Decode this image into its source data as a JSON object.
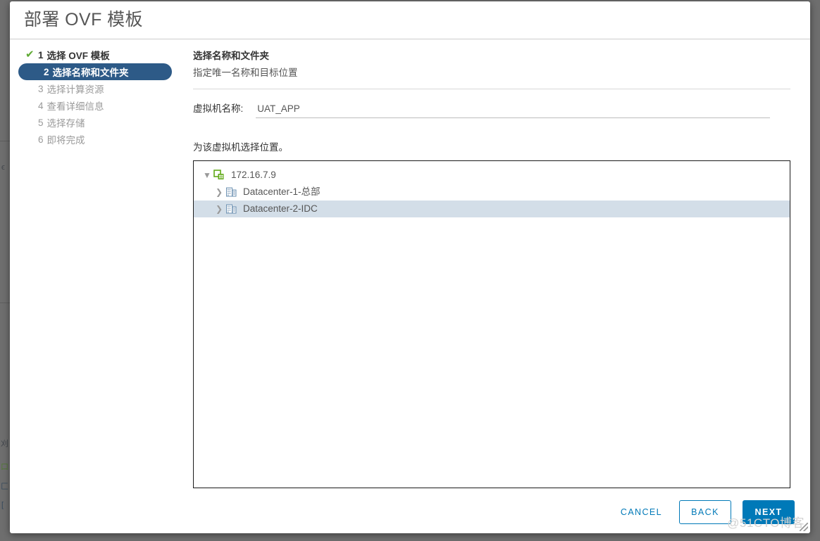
{
  "window": {
    "title": "部署 OVF 模板"
  },
  "steps": [
    {
      "num": "1",
      "label": "选择 OVF 模板",
      "state": "done",
      "icon": "check-icon"
    },
    {
      "num": "2",
      "label": "选择名称和文件夹",
      "state": "active",
      "icon": ""
    },
    {
      "num": "3",
      "label": "选择计算资源",
      "state": "pending",
      "icon": ""
    },
    {
      "num": "4",
      "label": "查看详细信息",
      "state": "pending",
      "icon": ""
    },
    {
      "num": "5",
      "label": "选择存储",
      "state": "pending",
      "icon": ""
    },
    {
      "num": "6",
      "label": "即将完成",
      "state": "pending",
      "icon": ""
    }
  ],
  "content": {
    "section_title": "选择名称和文件夹",
    "section_subtitle": "指定唯一名称和目标位置",
    "vm_name_label": "虚拟机名称:",
    "vm_name_value": "UAT_APP",
    "vm_name_placeholder": "",
    "location_label": "为该虚拟机选择位置。"
  },
  "tree": [
    {
      "label": "172.16.7.9",
      "level": 0,
      "twisty": "▼",
      "expanded": true,
      "selected": false,
      "icon": "vcenter-server-icon"
    },
    {
      "label": "Datacenter-1-总部",
      "level": 1,
      "twisty": "❯",
      "expanded": false,
      "selected": false,
      "icon": "datacenter-icon"
    },
    {
      "label": "Datacenter-2-IDC",
      "level": 1,
      "twisty": "❯",
      "expanded": false,
      "selected": true,
      "icon": "datacenter-icon"
    }
  ],
  "footer": {
    "cancel_label": "CANCEL",
    "back_label": "BACK",
    "next_label": "NEXT"
  },
  "watermark": "@51CTO博客",
  "background_glyphs": [
    "ϵ",
    "刈",
    "口",
    "匚",
    "["
  ],
  "colors": {
    "accent_blue": "#0079b8",
    "active_step_blue": "#2d5a87",
    "check_green": "#5faa33",
    "selected_row": "#d3dee8",
    "backdrop": "#6e6e6e",
    "tree_border": "#1a1a1a"
  }
}
